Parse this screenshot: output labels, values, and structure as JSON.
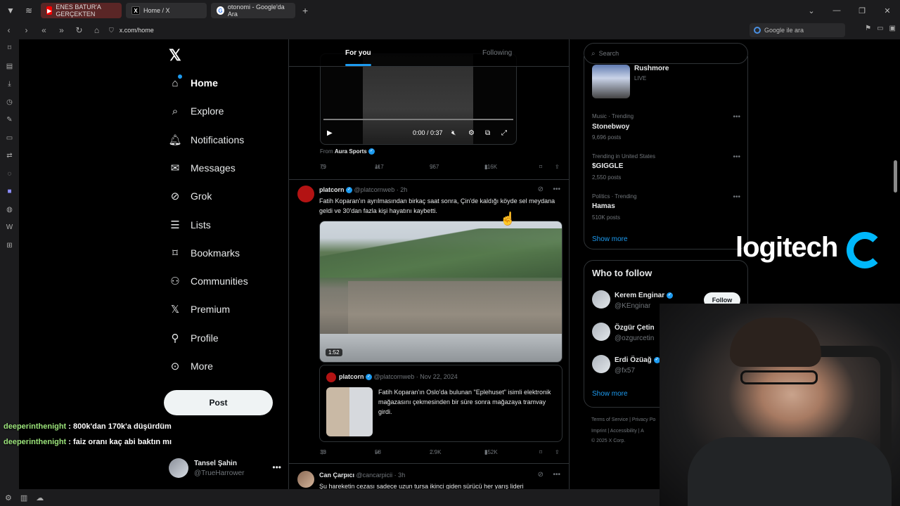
{
  "browser": {
    "tabs": [
      {
        "label": "ENES BATUR'A GERÇEKTEN"
      },
      {
        "label": "Home / X"
      },
      {
        "label": "otonomi - Google'da Ara"
      }
    ],
    "url": "x.com/home",
    "search_placeholder": "Google ile ara"
  },
  "nav": {
    "logo": "𝕏",
    "items": [
      {
        "label": "Home",
        "icon": "home-icon"
      },
      {
        "label": "Explore",
        "icon": "search-icon"
      },
      {
        "label": "Notifications",
        "icon": "bell-icon"
      },
      {
        "label": "Messages",
        "icon": "envelope-icon"
      },
      {
        "label": "Grok",
        "icon": "grok-icon"
      },
      {
        "label": "Lists",
        "icon": "list-icon"
      },
      {
        "label": "Bookmarks",
        "icon": "bookmark-icon"
      },
      {
        "label": "Communities",
        "icon": "people-icon"
      },
      {
        "label": "Premium",
        "icon": "x-icon"
      },
      {
        "label": "Profile",
        "icon": "person-icon"
      },
      {
        "label": "More",
        "icon": "more-circle-icon"
      }
    ],
    "post_label": "Post",
    "account": {
      "name": "Tansel Şahin",
      "handle": "@TrueHarrower"
    }
  },
  "chat": [
    {
      "user": "deeperinthenight",
      "text": " : 800k'dan 170k'a düşürdüm"
    },
    {
      "user": "deeperinthenight",
      "text": " : faiz oranı kaç abi baktın mı"
    }
  ],
  "feed": {
    "tabs": [
      "For you",
      "Following"
    ],
    "video_time": "0:00 / 0:37",
    "from_label": "From",
    "from_name": "Aura Sports",
    "tweet0_stats": {
      "replies": "79",
      "reposts": "117",
      "likes": "967",
      "views": "116K"
    },
    "tweet1": {
      "name": "platcorn",
      "handle": "@platcornweb · 2h",
      "text": "Fatih Koparan'ın ayrılmasından birkaç saat sonra, Çin'de kaldığı köyde sel meydana geldi ve 30'dan fazla kişi hayatını kaybetti.",
      "duration": "1:52",
      "quote": {
        "name": "platcorn",
        "handle": "@platcornweb · Nov 22, 2024",
        "text": "Fatih Koparan'ın Oslo'da bulunan \"Eplehuset\" isimli elektronik mağazasını çekmesinden bir süre sonra mağazaya tramvay girdi."
      },
      "stats": {
        "replies": "38",
        "reposts": "58",
        "likes": "2.9K",
        "views": "352K"
      }
    },
    "tweet2": {
      "name": "Can Çarpıcı",
      "handle": "@cancarpicii · 3h",
      "text": "Şu hareketin cezası sadece uzun tursa ikinci giden sürücü her yarış lideri"
    }
  },
  "right": {
    "search_placeholder": "Search",
    "trends": [
      {
        "category": "",
        "name": "Rushmore",
        "posts": "LIVE"
      },
      {
        "category": "Music · Trending",
        "name": "Stonebwoy",
        "posts": "9,696 posts"
      },
      {
        "category": "Trending in United States",
        "name": "$GIGGLE",
        "posts": "2,550 posts"
      },
      {
        "category": "Politics · Trending",
        "name": "Hamas",
        "posts": "510K posts"
      }
    ],
    "show_more": "Show more",
    "who_to_follow": {
      "title": "Who to follow",
      "people": [
        {
          "name": "Kerem Enginar",
          "handle": "@KEnginar"
        },
        {
          "name": "Özgür Çetin",
          "handle": "@ozgurcetin"
        },
        {
          "name": "Erdi Özüağ",
          "handle": "@fx57"
        }
      ],
      "follow_label": "Follow",
      "show_more": "Show more"
    },
    "footer": {
      "line1": "Terms of Service  |  Privacy Po",
      "line2": "Imprint  |  Accessibility  |  A",
      "line3": "© 2025 X Corp."
    }
  },
  "overlay": {
    "brand": "logitech"
  },
  "colors": {
    "accent": "#1d9bf0",
    "bg": "#000000",
    "muted": "#71767b",
    "chat_user": "#9be37a"
  }
}
